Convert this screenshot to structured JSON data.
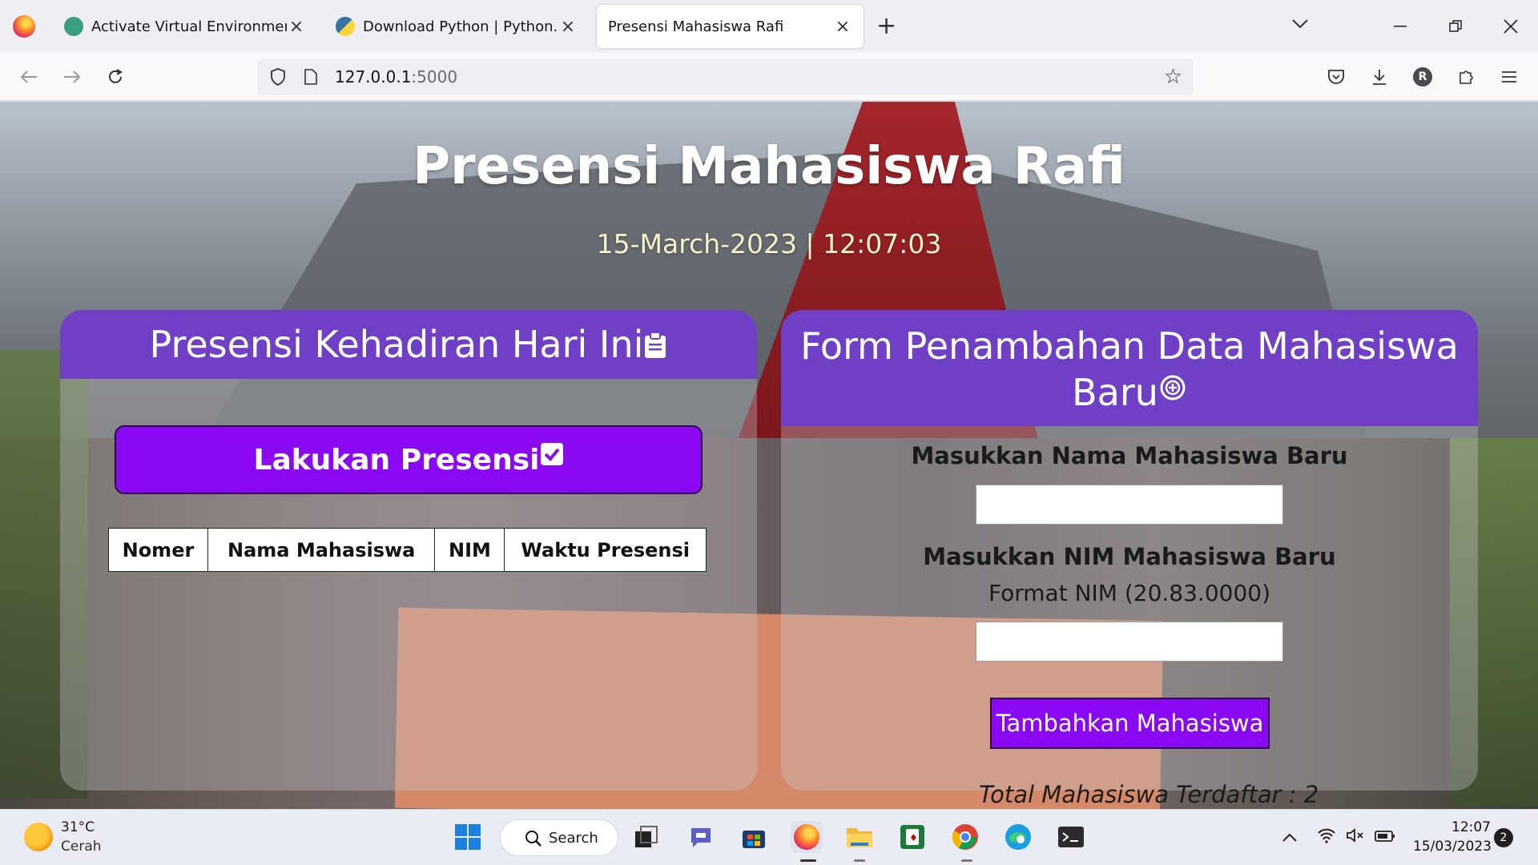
{
  "browser": {
    "tabs": [
      {
        "label": "Activate Virtual Environment.",
        "icon": "openai-icon"
      },
      {
        "label": "Download Python | Python.org",
        "icon": "python-icon"
      },
      {
        "label": "Presensi Mahasiswa Rafi",
        "icon": ""
      }
    ],
    "url_host": "127.0.0.1",
    "url_port": ":5000",
    "profile_initial": "R"
  },
  "page": {
    "title": "Presensi Mahasiswa Rafi",
    "datetime": "15-March-2023 | 12:07:03",
    "attendance": {
      "heading": "Presensi Kehadiran Hari Ini",
      "button_label": "Lakukan Presensi",
      "columns": [
        "Nomer",
        "Nama Mahasiswa",
        "NIM",
        "Waktu Presensi"
      ]
    },
    "form": {
      "heading_line1": "Form Penambahan Data Mahasiswa",
      "heading_line2": "Baru",
      "name_label": "Masukkan Nama Mahasiswa Baru",
      "nim_label": "Masukkan NIM Mahasiswa Baru",
      "nim_hint": "Format NIM (20.83.0000)",
      "name_value": "",
      "nim_value": "",
      "submit_label": "Tambahkan Mahasiswa"
    },
    "total_registered": "Total Mahasiswa Terdaftar : 2"
  },
  "taskbar": {
    "weather_temp": "31°C",
    "weather_desc": "Cerah",
    "search_label": "Search",
    "time": "12:07",
    "date": "15/03/2023",
    "notifications": "2"
  },
  "colors": {
    "header_purple": "#6f3fc6",
    "button_purple": "#8a08f2",
    "datetime_yellow": "#f6f3c8"
  }
}
